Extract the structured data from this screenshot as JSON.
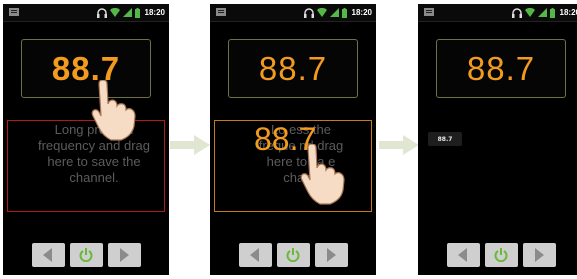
{
  "status_bar": {
    "time": "18:20",
    "icons": [
      "notification-icon",
      "headphones-icon",
      "wifi-icon",
      "signal-icon",
      "battery-icon"
    ]
  },
  "frequency": "88.7",
  "hint_lines": [
    "Long press the",
    "frequency and drag",
    "here to save the",
    "channel."
  ],
  "hint_visible_step1": [
    "Long press th",
    "frequency and drag",
    "here to save the",
    "channel."
  ],
  "hint_visible_step2": [
    "Lo          ess the",
    "freque       nd drag",
    "here to sa        e",
    "chann"
  ],
  "saved_channel": "88.7",
  "controls": {
    "prev": "previous-icon",
    "power": "power-icon",
    "next": "next-icon"
  },
  "colors": {
    "accent": "#f39b1f",
    "power": "#6ab83a",
    "drop_red": "#b01a1a",
    "drop_orange": "#c87a1a"
  }
}
